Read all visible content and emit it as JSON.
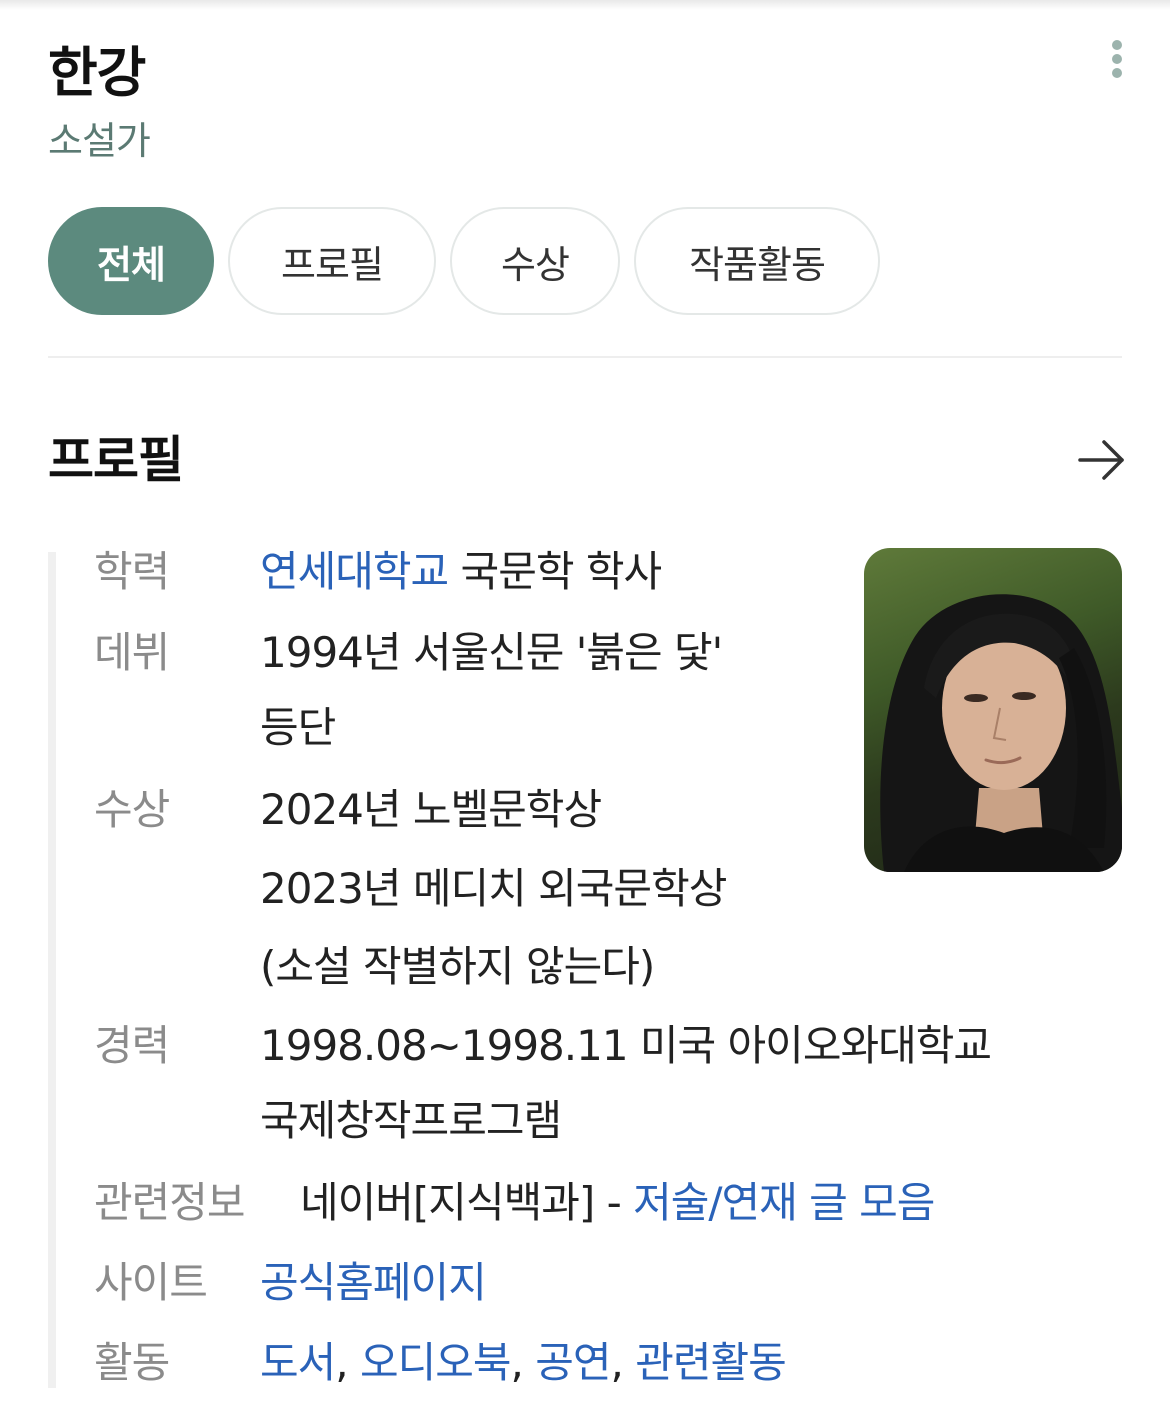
{
  "header": {
    "title": "한강",
    "subtitle": "소설가"
  },
  "tabs": [
    {
      "label": "전체",
      "active": true
    },
    {
      "label": "프로필",
      "active": false
    },
    {
      "label": "수상",
      "active": false
    },
    {
      "label": "작품활동",
      "active": false
    }
  ],
  "section": {
    "title": "프로필"
  },
  "profile": {
    "education": {
      "label": "학력",
      "school": "연세대학교",
      "rest": " 국문학 학사"
    },
    "debut": {
      "label": "데뷔",
      "line1": "1994년 서울신문 '붉은 닻'",
      "line2": "등단"
    },
    "awards": {
      "label": "수상",
      "line1": "2024년 노벨문학상",
      "line2": "2023년 메디치 외국문학상",
      "line3": "(소설 작별하지 않는다)"
    },
    "career": {
      "label": "경력",
      "line1": "1998.08~1998.11 미국 아이오와대학교",
      "line2": "국제창작프로그램"
    },
    "related": {
      "label": "관련정보",
      "text": "네이버[지식백과] - ",
      "link": "저술/연재 글 모음"
    },
    "site": {
      "label": "사이트",
      "link": "공식홈페이지"
    },
    "activity": {
      "label": "활동",
      "links": [
        "도서",
        "오디오북",
        "공연",
        "관련활동"
      ],
      "separator": ", "
    }
  },
  "colors": {
    "accent": "#5c8a7e",
    "subtitle": "#5b7a73",
    "link": "#2a62b8",
    "label": "#8b8b8b"
  },
  "icons": {
    "more": "more-vertical-icon",
    "arrow": "arrow-right-icon"
  }
}
